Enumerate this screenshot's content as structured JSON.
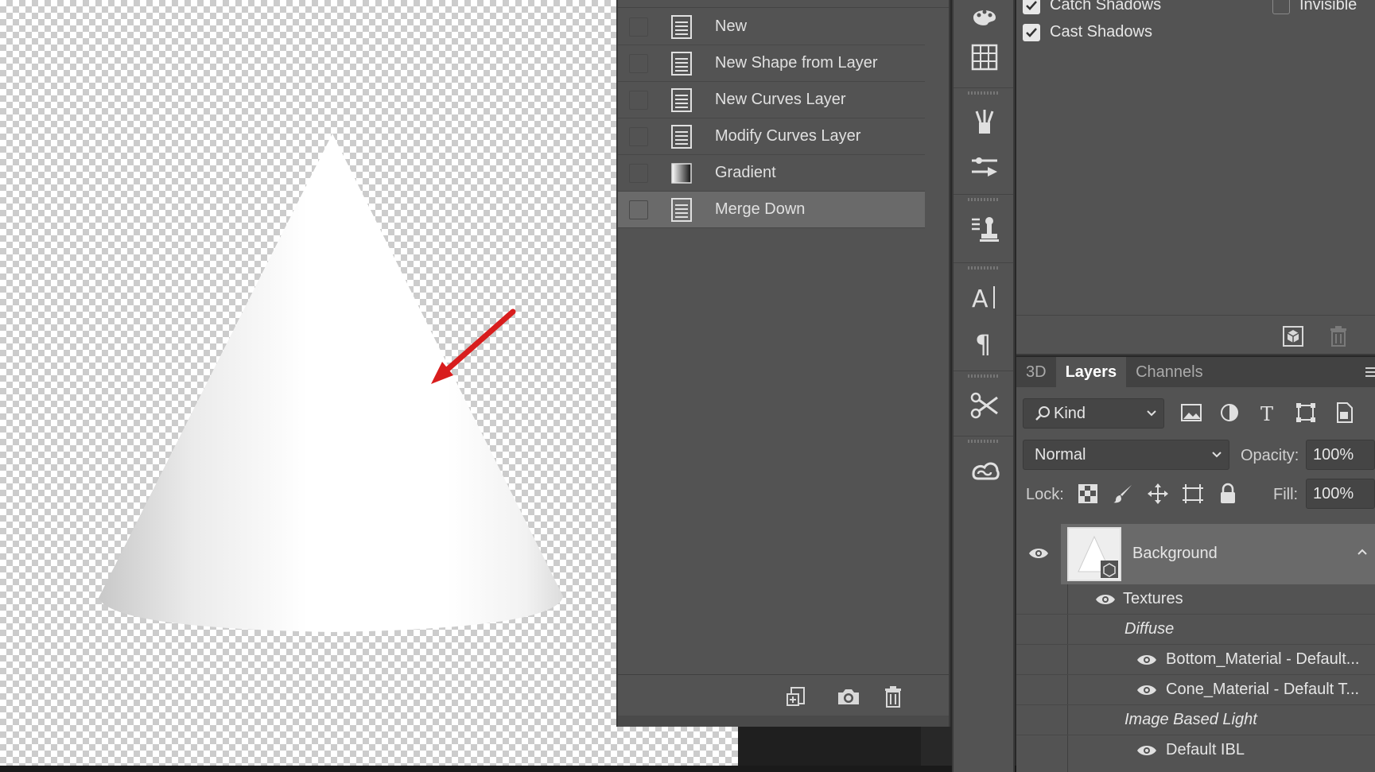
{
  "history": {
    "items": [
      {
        "label": "New",
        "icon": "document-icon",
        "selected": false
      },
      {
        "label": "New Shape from Layer",
        "icon": "document-icon",
        "selected": false
      },
      {
        "label": "New Curves Layer",
        "icon": "document-icon",
        "selected": false
      },
      {
        "label": "Modify Curves Layer",
        "icon": "document-icon",
        "selected": false
      },
      {
        "label": "Gradient",
        "icon": "gradient-icon",
        "selected": false
      },
      {
        "label": "Merge Down",
        "icon": "document-icon",
        "selected": true
      }
    ]
  },
  "properties": {
    "catch_shadows": {
      "label": "Catch Shadows",
      "checked": true
    },
    "invisible": {
      "label": "Invisible",
      "checked": false
    },
    "cast_shadows": {
      "label": "Cast Shadows",
      "checked": true
    }
  },
  "layers_panel": {
    "tabs": [
      "3D",
      "Layers",
      "Channels"
    ],
    "active_tab": "Layers",
    "filter": "Kind",
    "blend_mode": "Normal",
    "opacity_label": "Opacity:",
    "opacity": "100%",
    "lock_label": "Lock:",
    "fill_label": "Fill:",
    "fill": "100%",
    "layers": {
      "background": "Background",
      "textures": "Textures",
      "diffuse": "Diffuse",
      "bottom_material": "Bottom_Material - Default...",
      "cone_material": "Cone_Material - Default T...",
      "ibl_header": "Image Based Light",
      "default_ibl": "Default IBL"
    }
  },
  "colors": {
    "panel_bg": "#535353",
    "selected_row": "#6a6a6a",
    "arrow": "#e02020"
  }
}
